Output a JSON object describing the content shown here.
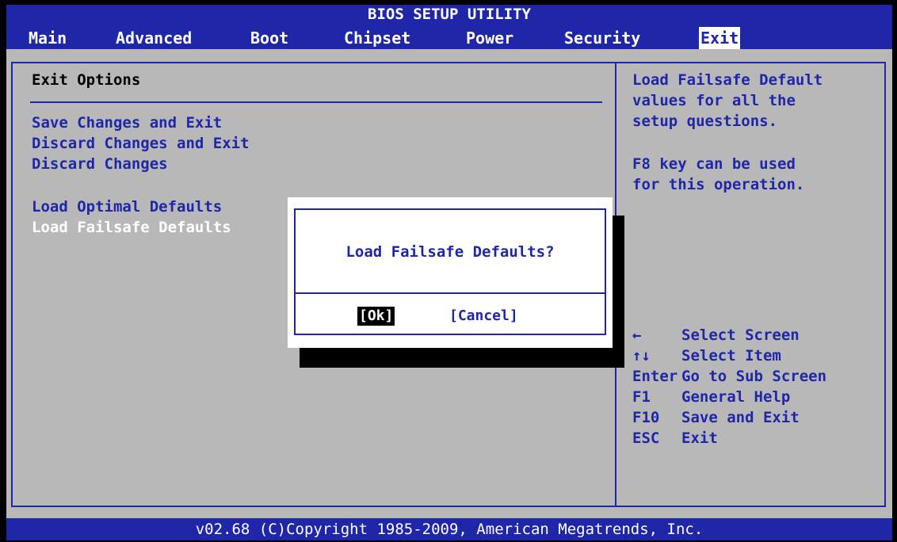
{
  "header": {
    "title": "BIOS SETUP UTILITY"
  },
  "menu": [
    {
      "label": "Main"
    },
    {
      "label": "Advanced"
    },
    {
      "label": "Boot"
    },
    {
      "label": "Chipset"
    },
    {
      "label": "Power"
    },
    {
      "label": "Security"
    },
    {
      "label": "Exit"
    }
  ],
  "active_menu": "Exit",
  "section": {
    "title": "Exit Options"
  },
  "options": [
    {
      "label": "Save Changes and Exit"
    },
    {
      "label": "Discard Changes and Exit"
    },
    {
      "label": "Discard Changes"
    },
    {
      "label": "Load Optimal Defaults"
    },
    {
      "label": "Load Failsafe Defaults"
    }
  ],
  "selected_option": "Load Failsafe Defaults",
  "help": {
    "lines": [
      "Load Failsafe Default",
      "values for all the",
      "setup questions.",
      "F8 key can be used",
      "for this operation."
    ]
  },
  "keys": [
    {
      "key": "←",
      "action": "Select Screen"
    },
    {
      "key": "↑↓",
      "action": "Select Item"
    },
    {
      "key": "Enter",
      "action": "Go to Sub Screen"
    },
    {
      "key": "F1",
      "action": "General Help"
    },
    {
      "key": "F10",
      "action": "Save and Exit"
    },
    {
      "key": "ESC",
      "action": "Exit"
    }
  ],
  "dialog": {
    "message": "Load Failsafe Defaults?",
    "ok_label": "[Ok]",
    "cancel_label": "[Cancel]"
  },
  "footer": {
    "text": "v02.68 (C)Copyright 1985-2009, American Megatrends, Inc."
  },
  "colors": {
    "blue": "#1f26a8",
    "panel": "#b8b8b8",
    "highlight": "#ffffff"
  }
}
